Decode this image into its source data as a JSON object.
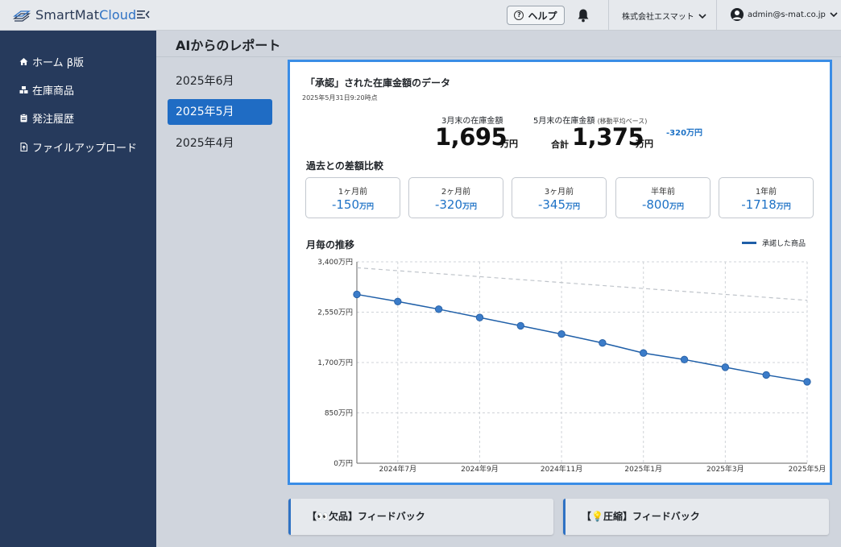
{
  "app": {
    "logo_smart": "SmartMat",
    "logo_cloud": "Cloud",
    "help_label": "ヘルプ",
    "company": "株式会社エスマット",
    "user_email": "admin@s-mat.co.jp"
  },
  "sidebar": {
    "items": [
      {
        "label": "ホーム β版",
        "icon": "home-icon"
      },
      {
        "label": "在庫商品",
        "icon": "inventory-icon"
      },
      {
        "label": "発注履歴",
        "icon": "clipboard-icon"
      },
      {
        "label": "ファイルアップロード",
        "icon": "file-upload-icon"
      }
    ]
  },
  "page": {
    "title": "AIからのレポート",
    "months": [
      "2025年6月",
      "2025年5月",
      "2025年4月"
    ],
    "active_month": "2025年5月"
  },
  "report": {
    "title": "「承認」された在庫金額のデータ",
    "timestamp": "2025年5月31日9:20時点",
    "march_label": "3月末の在庫金額",
    "march_value": "1,695",
    "march_unit": "万円",
    "may_label": "5月末の在庫金額",
    "may_note": "(移動平均ベース)",
    "total_label": "合計",
    "may_value": "1,375",
    "may_unit": "万円",
    "delta": "-320万円",
    "compare_heading": "過去との差額比較",
    "compare": [
      {
        "label": "1ヶ月前",
        "value": "-150",
        "unit": "万円"
      },
      {
        "label": "2ヶ月前",
        "value": "-320",
        "unit": "万円"
      },
      {
        "label": "3ヶ月前",
        "value": "-345",
        "unit": "万円"
      },
      {
        "label": "半年前",
        "value": "-800",
        "unit": "万円"
      },
      {
        "label": "1年前",
        "value": "-1718",
        "unit": "万円"
      }
    ],
    "trend_heading": "月毎の推移",
    "legend_label": "承諾した商品"
  },
  "feedback": {
    "missing": "【👀欠品】フィードバック",
    "compress": "【💡圧縮】フィードバック"
  },
  "chart_data": {
    "type": "line",
    "ylabel": "",
    "ylim": [
      0,
      3400
    ],
    "y_ticks": [
      "0万円",
      "850万円",
      "1,700万円",
      "2,550万円",
      "3,400万円"
    ],
    "y_tick_values": [
      0,
      850,
      1700,
      2550,
      3400
    ],
    "x_ticks": [
      "2024年7月",
      "2024年9月",
      "2024年11月",
      "2025年1月",
      "2025年3月",
      "2025年5月"
    ],
    "x": [
      "2024年6月",
      "2024年7月",
      "2024年8月",
      "2024年9月",
      "2024年10月",
      "2024年11月",
      "2024年12月",
      "2025年1月",
      "2025年2月",
      "2025年3月",
      "2025年4月",
      "2025年5月"
    ],
    "series": [
      {
        "name": "承諾した商品",
        "values": [
          2850,
          2730,
          2600,
          2460,
          2320,
          2180,
          2030,
          1860,
          1750,
          1620,
          1490,
          1375
        ],
        "color": "#1f5fa8"
      },
      {
        "values": [
          3300,
          3250,
          3200,
          3150,
          3100,
          3050,
          3000,
          2950,
          2900,
          2850,
          2800,
          2750
        ],
        "color": "#bfc4ca",
        "dashed": true
      }
    ],
    "grid": true
  }
}
